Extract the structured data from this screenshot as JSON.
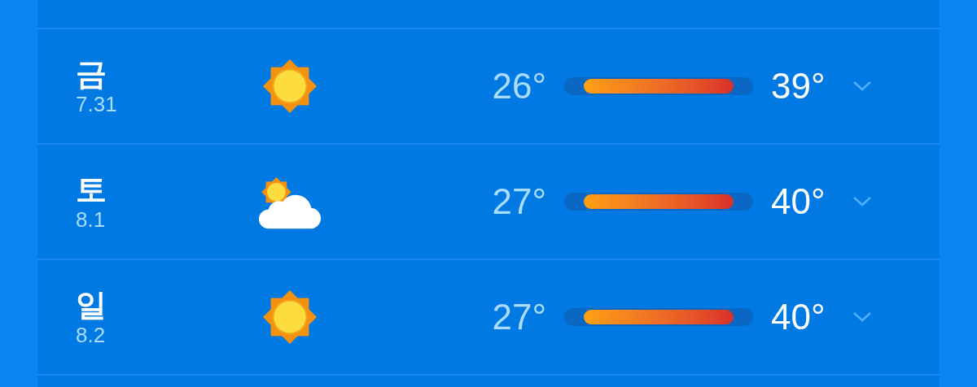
{
  "days": [
    {
      "weekday": "금",
      "date": "7.31",
      "kind": "sunny",
      "low": "26°",
      "high": "39°",
      "expanded": false
    },
    {
      "weekday": "토",
      "date": "8.1",
      "kind": "partly_cloudy",
      "low": "27°",
      "high": "40°",
      "expanded": false
    },
    {
      "weekday": "일",
      "date": "8.2",
      "kind": "sunny",
      "low": "27°",
      "high": "40°",
      "expanded": false
    }
  ]
}
